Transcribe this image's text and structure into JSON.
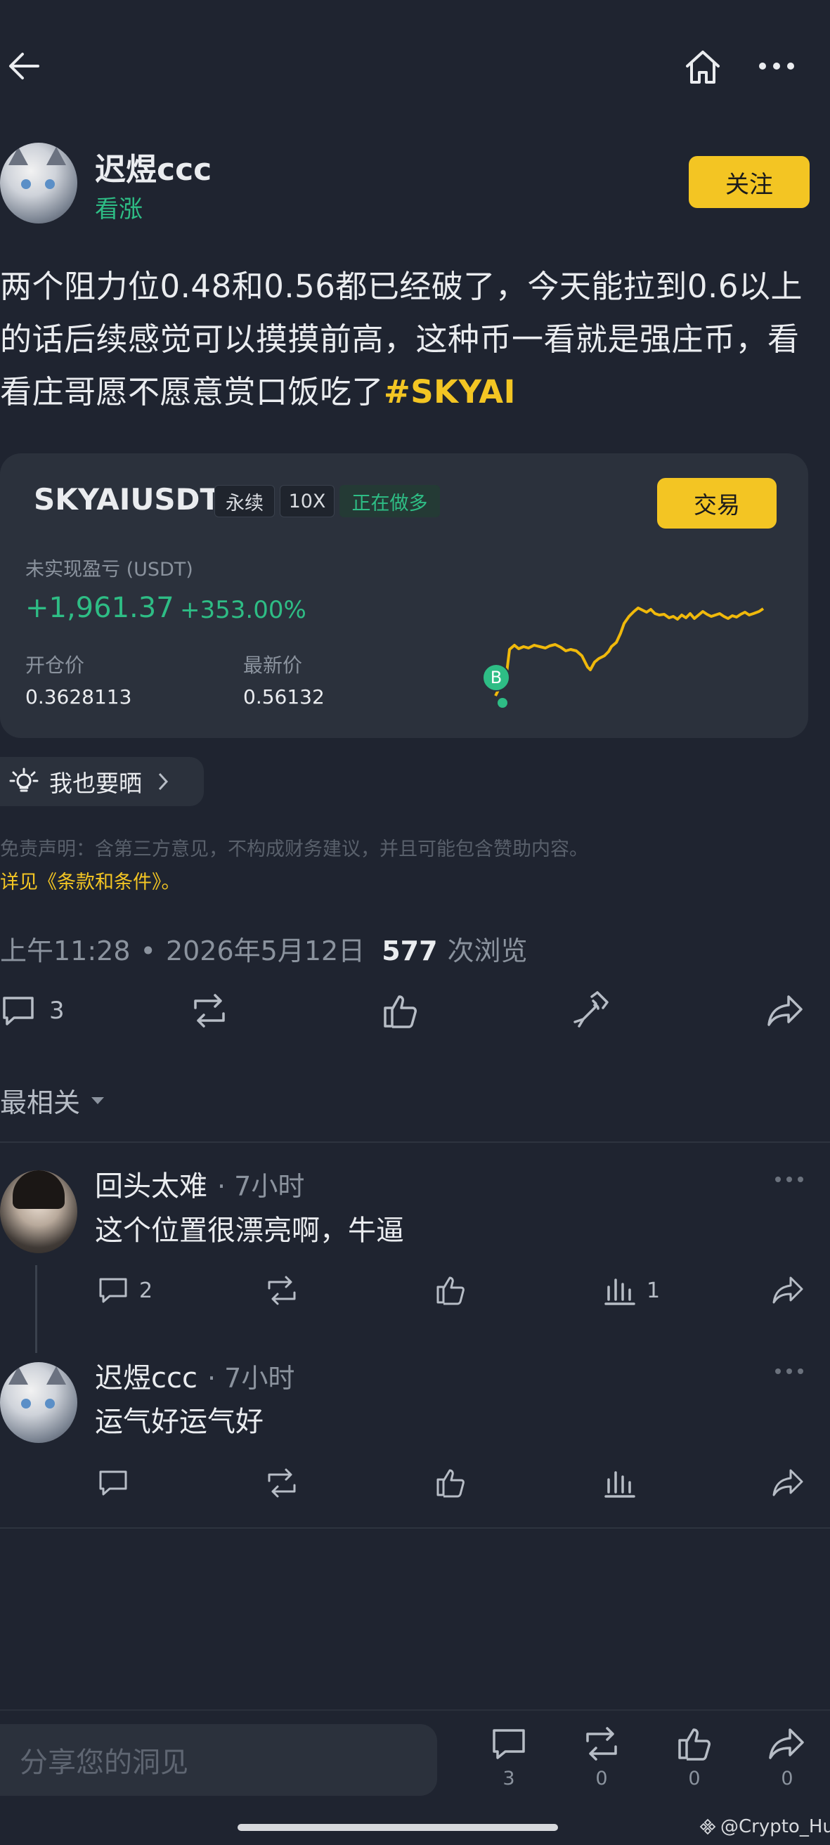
{
  "post": {
    "author_name": "迟煜ccc",
    "sentiment": "看涨",
    "follow_label": "关注",
    "text_before_tag": "两个阻力位0.48和0.56都已经破了，今天能拉到0.6以上的话后续感觉可以摸摸前高，这种币一看就是强庄币，看看庄哥愿不愿意赏口饭吃了",
    "hashtag": "#SKYAI"
  },
  "trade_card": {
    "symbol": "SKYAIUSDT",
    "badge_perpetual": "永续",
    "badge_leverage": "10X",
    "badge_side": "正在做多",
    "trade_label": "交易",
    "pnl_label": "未实现盈亏 (USDT)",
    "pnl_value": "+1,961.37",
    "pnl_percent": "+353.00%",
    "open_price_label": "开仓价",
    "open_price": "0.3628113",
    "last_price_label": "最新价",
    "last_price": "0.56132",
    "buy_marker": "B",
    "colors": {
      "line": "#f0b90b",
      "profit": "#2ebd85",
      "accent": "#f3c523"
    }
  },
  "share": {
    "label": "我也要晒"
  },
  "disclaimer": {
    "line1": "免责声明：含第三方意见，不构成财务建议，并且可能包含赞助内容。",
    "line2": "详见《条款和条件》。"
  },
  "meta": {
    "time": "上午11:28",
    "dot": "•",
    "date": "2026年5月12日",
    "views_count": "577",
    "views_label": "次浏览"
  },
  "actions": {
    "comment_count": "3"
  },
  "sort": {
    "label": "最相关"
  },
  "comments": [
    {
      "name": "回头太难",
      "time": "· 7小时",
      "text": "这个位置很漂亮啊，牛逼",
      "reply_count": "2",
      "views_count": "1"
    },
    {
      "name": "迟煜ccc",
      "time": "· 7小时",
      "text": "运气好运气好",
      "reply_count": "",
      "views_count": ""
    }
  ],
  "bottom_bar": {
    "input_placeholder": "分享您的洞见",
    "comment_count": "3",
    "repost_count": "0",
    "like_count": "0",
    "share_count": "0"
  },
  "watermark": {
    "text": "@Crypto_Hu"
  },
  "icons": [
    "back-arrow-icon",
    "home-icon",
    "more-icon",
    "lightbulb-icon",
    "chevron-right-icon",
    "comment-icon",
    "repost-icon",
    "like-icon",
    "tip-icon",
    "share-icon",
    "views-icon",
    "caret-down-icon"
  ]
}
